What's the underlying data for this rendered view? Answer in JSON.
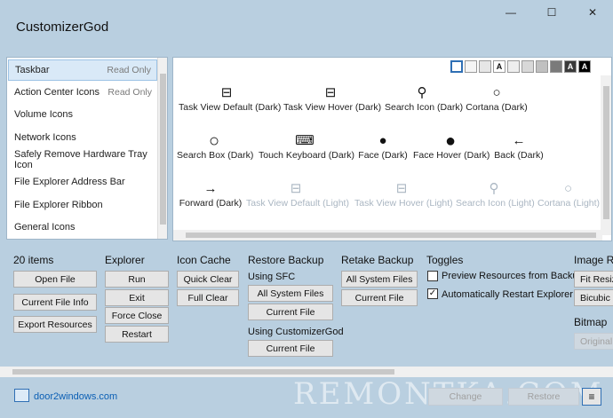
{
  "window": {
    "title": "CustomizerGod",
    "buttons": {
      "minimize": "—",
      "maximize": "☐",
      "close": "✕"
    }
  },
  "sidebar": {
    "items": [
      {
        "label": "Taskbar",
        "status": "Read Only",
        "selected": true
      },
      {
        "label": "Action Center Icons",
        "status": "Read Only",
        "selected": false
      },
      {
        "label": "Volume Icons",
        "status": "",
        "selected": false
      },
      {
        "label": "Network Icons",
        "status": "",
        "selected": false
      },
      {
        "label": "Safely Remove Hardware Tray Icon",
        "status": "",
        "selected": false
      },
      {
        "label": "File Explorer Address Bar",
        "status": "",
        "selected": false
      },
      {
        "label": "File Explorer Ribbon",
        "status": "",
        "selected": false
      },
      {
        "label": "General Icons",
        "status": "",
        "selected": false
      }
    ]
  },
  "swatches": [
    "",
    "",
    "",
    "A",
    "",
    "",
    "",
    "",
    "A",
    "A"
  ],
  "icons": {
    "row1": [
      {
        "label": "Task View Default (Dark)",
        "icon": "task-view-icon"
      },
      {
        "label": "Task View Hover (Dark)",
        "icon": "task-view-icon"
      },
      {
        "label": "Search Icon (Dark)",
        "icon": "search-icon"
      },
      {
        "label": "Cortana (Dark)",
        "icon": "cortana-icon"
      }
    ],
    "row2": [
      {
        "label": "Search Box (Dark)",
        "icon": "cortana-icon"
      },
      {
        "label": "Touch Keyboard (Dark)",
        "icon": "keyboard-icon"
      },
      {
        "label": "Face (Dark)",
        "icon": "face-icon"
      },
      {
        "label": "Face Hover (Dark)",
        "icon": "face-icon"
      },
      {
        "label": "Back (Dark)",
        "icon": "back-arrow-icon"
      }
    ],
    "row3": [
      {
        "label": "Forward (Dark)",
        "icon": "forward-arrow-icon"
      },
      {
        "label": "Task View Default (Light)",
        "icon": "task-view-icon"
      },
      {
        "label": "Task View Hover (Light)",
        "icon": "task-view-icon"
      },
      {
        "label": "Search Icon (Light)",
        "icon": "search-icon"
      },
      {
        "label": "Cortana (Light)",
        "icon": "cortana-icon"
      }
    ]
  },
  "groups": {
    "items": {
      "title": "20 items",
      "open_file": "Open File",
      "current_file_info": "Current File Info",
      "export_resources": "Export Resources"
    },
    "explorer": {
      "title": "Explorer",
      "run": "Run",
      "exit": "Exit",
      "force_close": "Force Close",
      "restart": "Restart"
    },
    "icon_cache": {
      "title": "Icon Cache",
      "quick_clear": "Quick Clear",
      "full_clear": "Full Clear"
    },
    "restore_backup": {
      "title": "Restore Backup",
      "using_sfc": "Using SFC",
      "all_system_files": "All System Files",
      "current_file": "Current File",
      "using_customizergod": "Using CustomizerGod",
      "current_file_2": "Current File"
    },
    "retake_backup": {
      "title": "Retake Backup",
      "all_system_files": "All System Files",
      "current_file": "Current File"
    },
    "toggles": {
      "title": "Toggles",
      "preview_resources": "Preview Resources from Backup",
      "preview_checked": false,
      "auto_restart": "Automatically Restart Explorer",
      "auto_restart_checked": true
    },
    "image": {
      "title": "Image R",
      "fit_resize": "Fit Resiz",
      "bicubic": "Bicubic",
      "bitmap_title": "Bitmap",
      "original": "Original"
    }
  },
  "footer": {
    "link": "door2windows.com",
    "change": "Change",
    "restore": "Restore",
    "menu": "≡",
    "watermark": "REMONTKA.COM"
  }
}
